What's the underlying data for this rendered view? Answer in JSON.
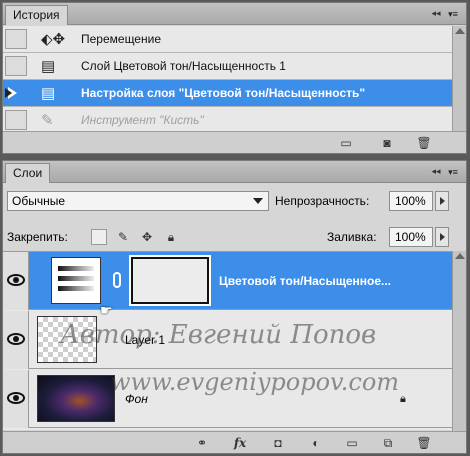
{
  "history": {
    "tab_label": "История",
    "items": [
      {
        "icon": "move-tool-icon",
        "label": "Перемещение"
      },
      {
        "icon": "document-icon",
        "label": "Слой Цветовой тон/Насыщенность 1"
      },
      {
        "icon": "document-icon",
        "label": "Настройка слоя \"Цветовой тон/Насыщенность\"",
        "selected": true
      },
      {
        "icon": "brush-icon",
        "label": "Инструмент \"Кисть\"",
        "dimmed": true
      }
    ],
    "footer_icons": [
      "new-document-from-state-icon",
      "snapshot-icon",
      "trash-icon"
    ]
  },
  "layers": {
    "tab_label": "Слои",
    "blend_mode": "Обычные",
    "opacity_label": "Непрозрачность:",
    "opacity_value": "100%",
    "lock_label": "Закрепить:",
    "lock_icons": [
      "lock-transparent-icon",
      "lock-brush-icon",
      "lock-move-icon",
      "lock-all-icon"
    ],
    "fill_label": "Заливка:",
    "fill_value": "100%",
    "items": [
      {
        "name": "Цветовой тон/Насыщенное...",
        "type": "adjustment",
        "visible": true,
        "selected": true
      },
      {
        "name": "Layer 1",
        "type": "pixel",
        "visible": true,
        "selected": false
      },
      {
        "name": "Фон",
        "type": "background",
        "visible": true,
        "selected": false,
        "locked": true
      }
    ],
    "footer_icons": [
      "link-layers-icon",
      "fx-icon",
      "layer-mask-icon",
      "adjustment-layer-icon",
      "group-folder-icon",
      "new-layer-icon",
      "trash-icon"
    ],
    "footer_fx_label": "fx"
  },
  "watermark": {
    "author": "Автор: Евгений Попов",
    "site": "www.evgeniypopov.com"
  }
}
